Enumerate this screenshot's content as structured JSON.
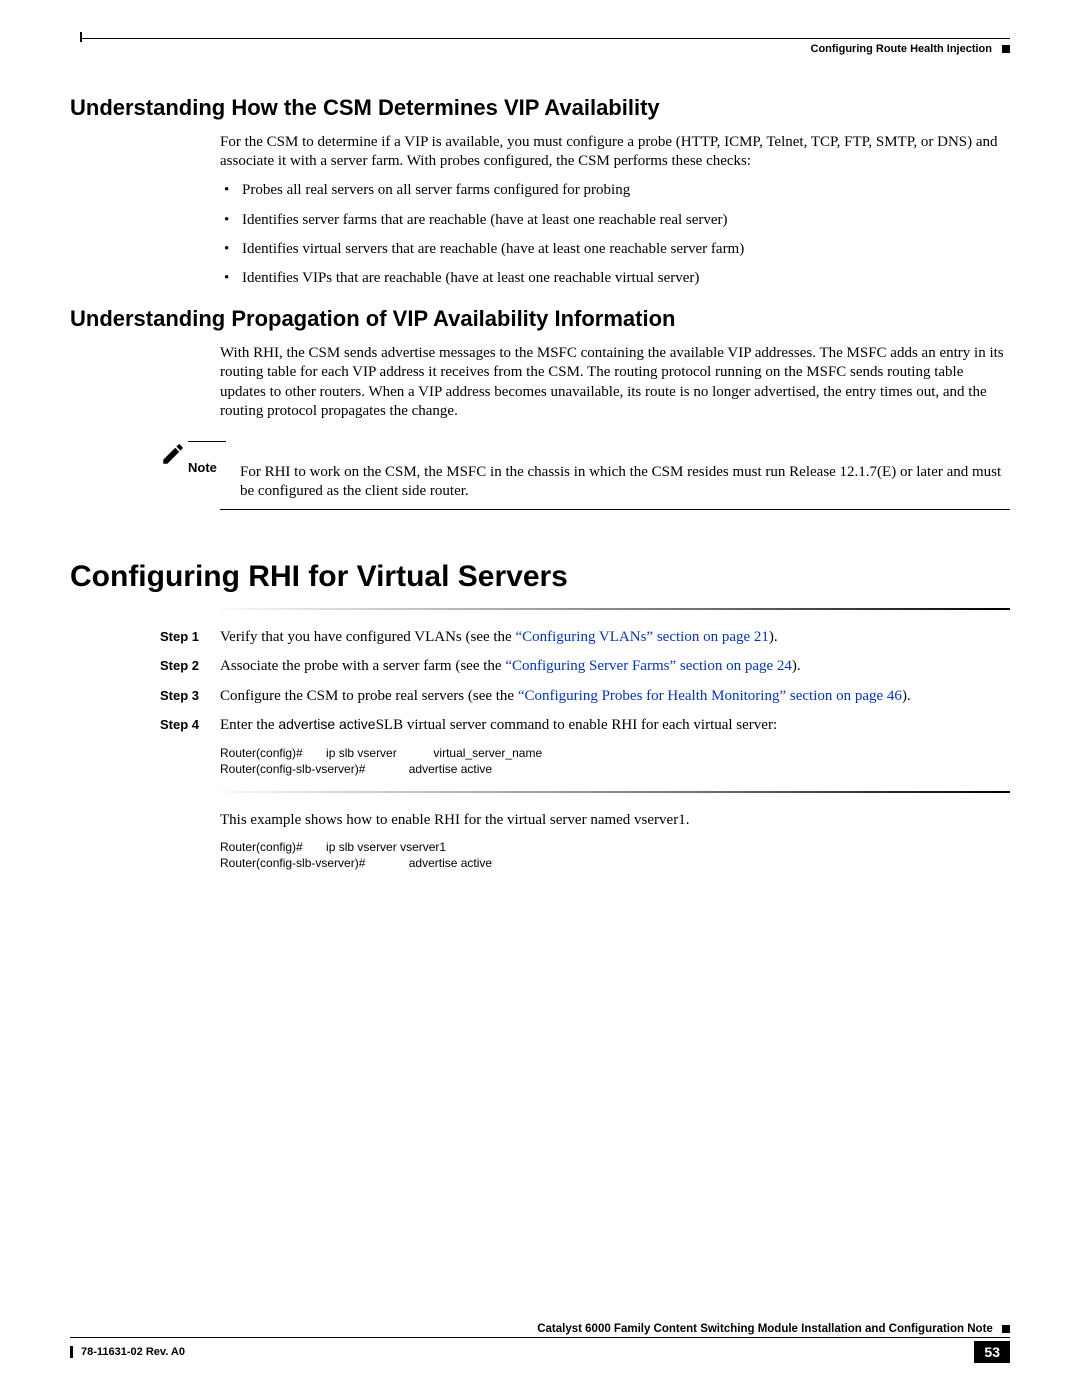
{
  "header": {
    "chapter_title": "Configuring Route Health Injection"
  },
  "sections": {
    "s1": {
      "title": "Understanding How the CSM Determines VIP Availability",
      "intro": "For the CSM to determine if a VIP is available, you must configure a probe (HTTP, ICMP, Telnet, TCP, FTP, SMTP, or DNS) and associate it with a server farm. With probes configured, the CSM performs these checks:",
      "bullets": [
        "Probes all real servers on all server farms configured for probing",
        "Identifies server farms that are reachable (have at least one reachable real server)",
        "Identifies virtual servers that are reachable (have at least one reachable server farm)",
        "Identifies VIPs that are reachable (have at least one reachable virtual server)"
      ]
    },
    "s2": {
      "title": "Understanding Propagation of VIP Availability Information",
      "para": "With RHI, the CSM sends advertise messages to the MSFC containing the available VIP addresses. The MSFC adds an entry in its routing table for each VIP address it receives from the CSM. The routing protocol running on the MSFC sends routing table updates to other routers. When a VIP address becomes unavailable, its route is no longer advertised, the entry times out, and the routing protocol propagates the change.",
      "note_label": "Note",
      "note_text": "For RHI to work on the CSM, the MSFC in the chassis in which the CSM resides must run Release 12.1.7(E) or later and must be configured as the client side router."
    },
    "s3": {
      "title": "Configuring RHI for Virtual Servers",
      "steps": [
        {
          "label": "Step 1",
          "pre": "Verify that you have configured VLANs (see the ",
          "link": "“Configuring VLANs” section on page 21",
          "post": ")."
        },
        {
          "label": "Step 2",
          "pre": "Associate the probe with a server farm (see the ",
          "link": "“Configuring Server Farms” section on page 24",
          "post": ")."
        },
        {
          "label": "Step 3",
          "pre": "Configure the CSM to probe real servers (see the ",
          "link": "“Configuring Probes for Health Monitoring” section on page 46",
          "post": ")."
        },
        {
          "label": "Step 4",
          "pre1": "Enter the ",
          "cmd": "advertise active",
          "pre2": "SLB virtual server command to enable RHI for each virtual server:"
        }
      ],
      "code1_l1": "Router(config)#       ip slb vserver           virtual_server_name",
      "code1_l2": "Router(config-slb-vserver)#             advertise active",
      "example_para": "This example shows how to enable RHI for the virtual server named vserver1.",
      "code2_l1": "Router(config)#       ip slb vserver vserver1",
      "code2_l2": "Router(config-slb-vserver)#             advertise active"
    }
  },
  "footer": {
    "doc_title": "Catalyst 6000 Family Content Switching Module Installation and Configuration Note",
    "rev": "78-11631-02 Rev. A0",
    "page": "53"
  }
}
